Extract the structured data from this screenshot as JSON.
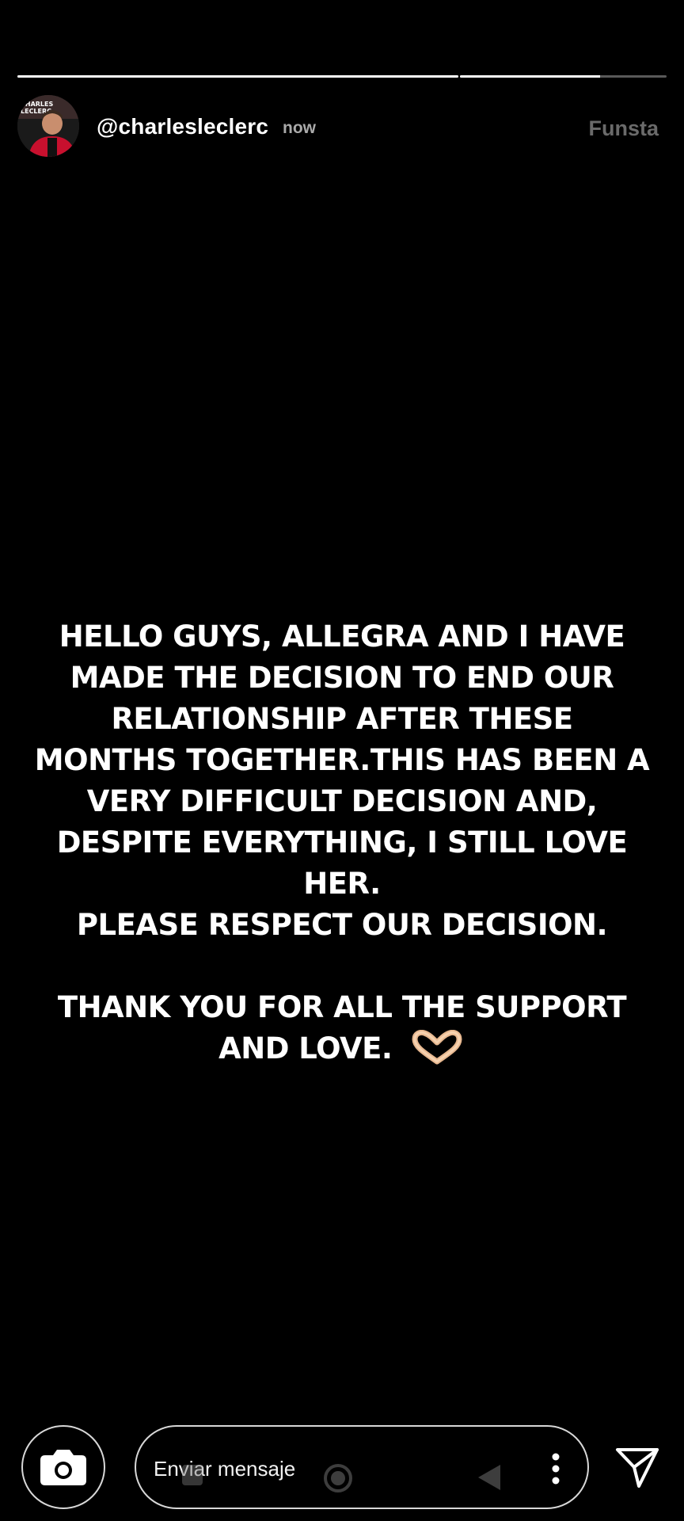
{
  "story": {
    "progress": [
      1.0,
      0.68
    ],
    "user": {
      "username": "@charlesleclerc",
      "timestamp": "now",
      "avatar_text": "CHARLES LECLERC"
    },
    "watermark": "Funsta",
    "text_lines": [
      "HELLO GUYS, ALLEGRA AND I HAVE",
      "MADE THE DECISION TO END OUR",
      "RELATIONSHIP AFTER THESE",
      "MONTHS TOGETHER.THIS HAS BEEN A",
      "VERY DIFFICULT DECISION AND,",
      "DESPITE EVERYTHING, I STILL LOVE",
      "HER.",
      "PLEASE RESPECT OUR DECISION.",
      "",
      "THANK YOU FOR ALL THE SUPPORT"
    ],
    "last_line": "AND LOVE.",
    "emoji": "heart-hands"
  },
  "footer": {
    "message_placeholder": "Enviar mensaje",
    "icons": [
      "camera-icon",
      "more-vertical-icon",
      "send-icon"
    ]
  },
  "colors": {
    "background": "#000000",
    "text": "#ffffff",
    "timestamp": "#aaaaaa",
    "watermark": "#6a6a6a"
  }
}
